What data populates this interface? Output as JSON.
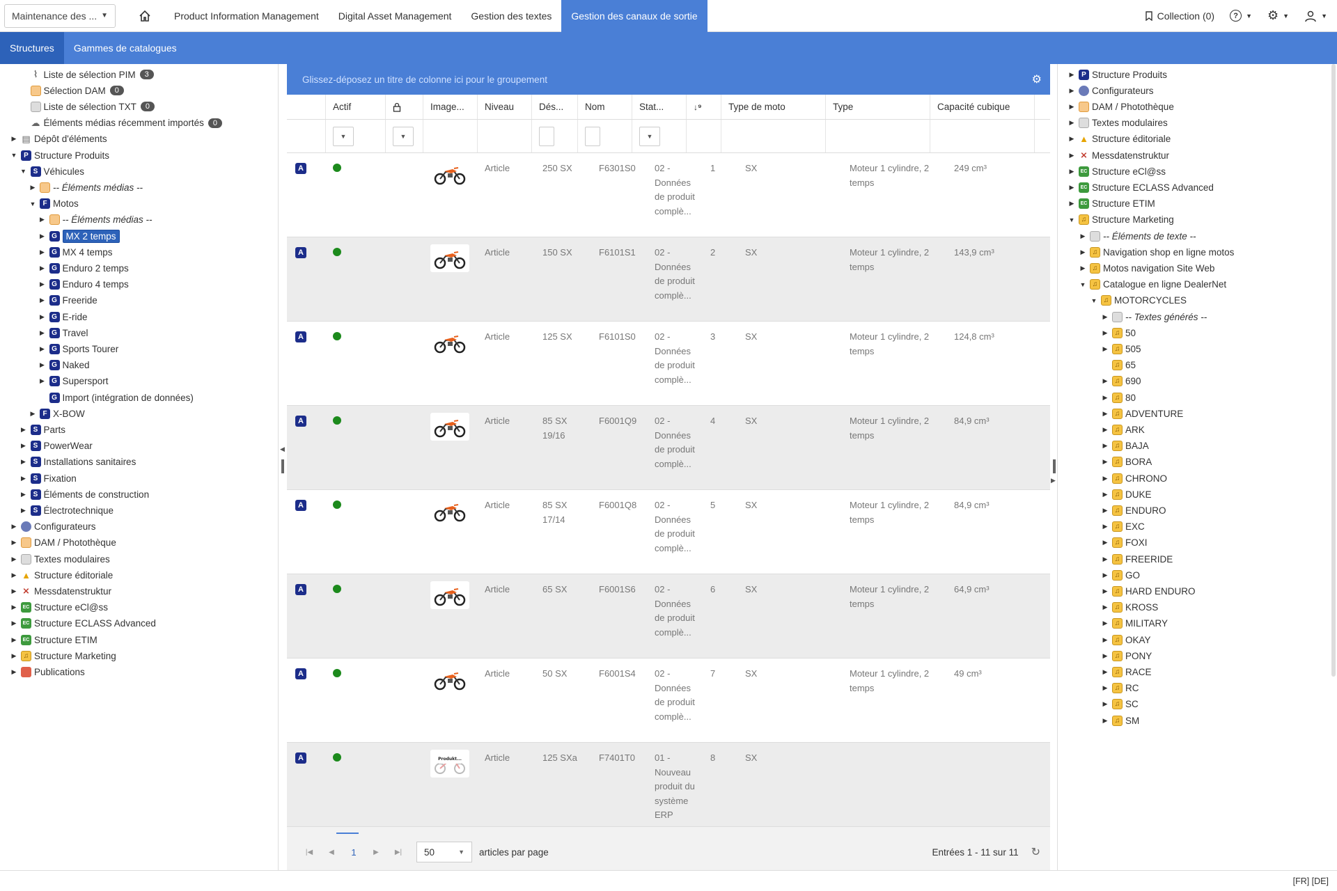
{
  "topbar": {
    "context_select": "Maintenance des ...",
    "nav_tabs": [
      {
        "label": "Product Information Management"
      },
      {
        "label": "Digital Asset Management"
      },
      {
        "label": "Gestion des textes"
      },
      {
        "label": "Gestion des canaux de sortie"
      }
    ],
    "active_tab": "Gestion des canaux de sortie",
    "collection": "Collection (0)"
  },
  "subbar": {
    "tabs": [
      {
        "label": "Structures"
      },
      {
        "label": "Gammes de catalogues"
      }
    ]
  },
  "left_tree": [
    {
      "label": "Liste de sélection PIM",
      "icon": "paperclip-icon",
      "badge": "3",
      "depth": 1,
      "toggle": ""
    },
    {
      "label": "Sélection DAM",
      "icon": "image-icon",
      "badge": "0",
      "depth": 1,
      "toggle": ""
    },
    {
      "label": "Liste de sélection TXT",
      "icon": "text-icon",
      "badge": "0",
      "depth": 1,
      "toggle": ""
    },
    {
      "label": "Éléments médias récemment importés",
      "icon": "import-icon",
      "badge": "0",
      "depth": 1,
      "toggle": ""
    },
    {
      "label": "Dépôt d'éléments",
      "icon": "clipboard-icon",
      "depth": 0,
      "toggle": "closed"
    },
    {
      "label": "Structure Produits",
      "icon": "P",
      "depth": 0,
      "toggle": "open"
    },
    {
      "label": "Véhicules",
      "icon": "S",
      "depth": 1,
      "toggle": "open"
    },
    {
      "label": "-- Éléments médias --",
      "icon": "dam-icon",
      "depth": 2,
      "toggle": "closed",
      "italic": true
    },
    {
      "label": "Motos",
      "icon": "F",
      "depth": 2,
      "toggle": "open"
    },
    {
      "label": "-- Éléments médias --",
      "icon": "dam-icon",
      "depth": 3,
      "toggle": "closed",
      "italic": true
    },
    {
      "label": "MX 2 temps",
      "icon": "G",
      "depth": 3,
      "toggle": "closed",
      "selected": true
    },
    {
      "label": "MX 4 temps",
      "icon": "G",
      "depth": 3,
      "toggle": "closed"
    },
    {
      "label": "Enduro 2 temps",
      "icon": "G",
      "depth": 3,
      "toggle": "closed"
    },
    {
      "label": "Enduro 4 temps",
      "icon": "G",
      "depth": 3,
      "toggle": "closed"
    },
    {
      "label": "Freeride",
      "icon": "G",
      "depth": 3,
      "toggle": "closed"
    },
    {
      "label": "E-ride",
      "icon": "G",
      "depth": 3,
      "toggle": "closed"
    },
    {
      "label": "Travel",
      "icon": "G",
      "depth": 3,
      "toggle": "closed"
    },
    {
      "label": "Sports Tourer",
      "icon": "G",
      "depth": 3,
      "toggle": "closed"
    },
    {
      "label": "Naked",
      "icon": "G",
      "depth": 3,
      "toggle": "closed"
    },
    {
      "label": "Supersport",
      "icon": "G",
      "depth": 3,
      "toggle": "closed"
    },
    {
      "label": "Import (intégration de données)",
      "icon": "G",
      "depth": 3,
      "toggle": ""
    },
    {
      "label": "X-BOW",
      "icon": "F",
      "depth": 2,
      "toggle": "closed"
    },
    {
      "label": "Parts",
      "icon": "S",
      "depth": 1,
      "toggle": "closed"
    },
    {
      "label": "PowerWear",
      "icon": "S",
      "depth": 1,
      "toggle": "closed"
    },
    {
      "label": "Installations sanitaires",
      "icon": "S",
      "depth": 1,
      "toggle": "closed"
    },
    {
      "label": "Fixation",
      "icon": "S",
      "depth": 1,
      "toggle": "closed"
    },
    {
      "label": "Éléments de construction",
      "icon": "S",
      "depth": 1,
      "toggle": "closed"
    },
    {
      "label": "Électrotechnique",
      "icon": "S",
      "depth": 1,
      "toggle": "closed"
    },
    {
      "label": "Configurateurs",
      "icon": "cfg-icon",
      "depth": 0,
      "toggle": "closed"
    },
    {
      "label": "DAM / Photothèque",
      "icon": "dam-icon",
      "depth": 0,
      "toggle": "closed"
    },
    {
      "label": "Textes modulaires",
      "icon": "txt-icon",
      "depth": 0,
      "toggle": "closed"
    },
    {
      "label": "Structure éditoriale",
      "icon": "edit-icon",
      "depth": 0,
      "toggle": "closed"
    },
    {
      "label": "Messdatenstruktur",
      "icon": "mess-icon",
      "depth": 0,
      "toggle": "closed"
    },
    {
      "label": "Structure eCl@ss",
      "icon": "eclass-icon",
      "depth": 0,
      "toggle": "closed"
    },
    {
      "label": "Structure ECLASS Advanced",
      "icon": "eclass-icon",
      "depth": 0,
      "toggle": "closed"
    },
    {
      "label": "Structure ETIM",
      "icon": "eclass-icon",
      "depth": 0,
      "toggle": "closed"
    },
    {
      "label": "Structure Marketing",
      "icon": "mkt-icon",
      "depth": 0,
      "toggle": "closed"
    },
    {
      "label": "Publications",
      "icon": "pub-icon",
      "depth": 0,
      "toggle": "closed"
    }
  ],
  "grid": {
    "group_hint": "Glissez-déposez un titre de colonne ici pour le groupement",
    "columns": [
      "Actif",
      "Image...",
      "Niveau",
      "Dés...",
      "Nom",
      "Stat...",
      "Type de moto",
      "Type",
      "Capacité cubique"
    ],
    "rows": [
      {
        "niveau": "Article",
        "des": "250 SX",
        "nom": "F6301S0",
        "stat": "02 - Données de produit complè...",
        "num": "1",
        "moto": "SX",
        "type": "Moteur 1 cylindre, 2 temps",
        "cap": "249 cm³"
      },
      {
        "niveau": "Article",
        "des": "150 SX",
        "nom": "F6101S1",
        "stat": "02 - Données de produit complè...",
        "num": "2",
        "moto": "SX",
        "type": "Moteur 1 cylindre, 2 temps",
        "cap": "143,9 cm³"
      },
      {
        "niveau": "Article",
        "des": "125 SX",
        "nom": "F6101S0",
        "stat": "02 - Données de produit complè...",
        "num": "3",
        "moto": "SX",
        "type": "Moteur 1 cylindre, 2 temps",
        "cap": "124,8 cm³"
      },
      {
        "niveau": "Article",
        "des": "85 SX 19/16",
        "nom": "F6001Q9",
        "stat": "02 - Données de produit complè...",
        "num": "4",
        "moto": "SX",
        "type": "Moteur 1 cylindre, 2 temps",
        "cap": "84,9 cm³"
      },
      {
        "niveau": "Article",
        "des": "85 SX 17/14",
        "nom": "F6001Q8",
        "stat": "02 - Données de produit complè...",
        "num": "5",
        "moto": "SX",
        "type": "Moteur 1 cylindre, 2 temps",
        "cap": "84,9 cm³"
      },
      {
        "niveau": "Article",
        "des": "65 SX",
        "nom": "F6001S6",
        "stat": "02 - Données de produit complè...",
        "num": "6",
        "moto": "SX",
        "type": "Moteur 1 cylindre, 2 temps",
        "cap": "64,9 cm³"
      },
      {
        "niveau": "Article",
        "des": "50 SX",
        "nom": "F6001S4",
        "stat": "02 - Données de produit complè...",
        "num": "7",
        "moto": "SX",
        "type": "Moteur 1 cylindre, 2 temps",
        "cap": "49 cm³"
      },
      {
        "niveau": "Article",
        "des": "125 SXa",
        "nom": "F7401T0",
        "stat": "01 - Nouveau produit du système ERP",
        "num": "8",
        "moto": "SX",
        "type": "",
        "cap": "",
        "placeholder_image": true
      }
    ],
    "pager": {
      "page": "1",
      "page_size": "50",
      "per_page_label": "articles par page",
      "entries": "Entrées 1 - 11 sur 11"
    }
  },
  "right_tree": [
    {
      "label": "Structure Produits",
      "icon": "P",
      "depth": 0,
      "toggle": "closed"
    },
    {
      "label": "Configurateurs",
      "icon": "cfg-icon",
      "depth": 0,
      "toggle": "closed"
    },
    {
      "label": "DAM / Photothèque",
      "icon": "dam-icon",
      "depth": 0,
      "toggle": "closed"
    },
    {
      "label": "Textes modulaires",
      "icon": "txt-icon",
      "depth": 0,
      "toggle": "closed"
    },
    {
      "label": "Structure éditoriale",
      "icon": "edit-icon",
      "depth": 0,
      "toggle": "closed"
    },
    {
      "label": "Messdatenstruktur",
      "icon": "mess-icon",
      "depth": 0,
      "toggle": "closed"
    },
    {
      "label": "Structure eCl@ss",
      "icon": "eclass-icon",
      "depth": 0,
      "toggle": "closed"
    },
    {
      "label": "Structure ECLASS Advanced",
      "icon": "eclass-icon",
      "depth": 0,
      "toggle": "closed"
    },
    {
      "label": "Structure ETIM",
      "icon": "eclass-icon",
      "depth": 0,
      "toggle": "closed"
    },
    {
      "label": "Structure Marketing",
      "icon": "mkt-icon",
      "depth": 0,
      "toggle": "open"
    },
    {
      "label": "-- Éléments de texte --",
      "icon": "txt-icon",
      "depth": 1,
      "toggle": "closed",
      "italic": true
    },
    {
      "label": "Navigation shop en ligne motos",
      "icon": "mkt-icon",
      "depth": 1,
      "toggle": "closed"
    },
    {
      "label": "Motos navigation Site Web",
      "icon": "mkt-icon",
      "depth": 1,
      "toggle": "closed"
    },
    {
      "label": "Catalogue en ligne DealerNet",
      "icon": "mkt-icon",
      "depth": 1,
      "toggle": "open"
    },
    {
      "label": "MOTORCYCLES",
      "icon": "mkt-icon",
      "depth": 2,
      "toggle": "open"
    },
    {
      "label": "-- Textes générés --",
      "icon": "txt-icon",
      "depth": 3,
      "toggle": "closed",
      "italic": true
    },
    {
      "label": "50",
      "icon": "mkt-icon",
      "depth": 3,
      "toggle": "closed"
    },
    {
      "label": "505",
      "icon": "mkt-icon",
      "depth": 3,
      "toggle": "closed"
    },
    {
      "label": "65",
      "icon": "mkt-icon",
      "depth": 3,
      "toggle": ""
    },
    {
      "label": "690",
      "icon": "mkt-icon",
      "depth": 3,
      "toggle": "closed"
    },
    {
      "label": "80",
      "icon": "mkt-icon",
      "depth": 3,
      "toggle": "closed"
    },
    {
      "label": "ADVENTURE",
      "icon": "mkt-icon",
      "depth": 3,
      "toggle": "closed"
    },
    {
      "label": "ARK",
      "icon": "mkt-icon",
      "depth": 3,
      "toggle": "closed"
    },
    {
      "label": "BAJA",
      "icon": "mkt-icon",
      "depth": 3,
      "toggle": "closed"
    },
    {
      "label": "BORA",
      "icon": "mkt-icon",
      "depth": 3,
      "toggle": "closed"
    },
    {
      "label": "CHRONO",
      "icon": "mkt-icon",
      "depth": 3,
      "toggle": "closed"
    },
    {
      "label": "DUKE",
      "icon": "mkt-icon",
      "depth": 3,
      "toggle": "closed"
    },
    {
      "label": "ENDURO",
      "icon": "mkt-icon",
      "depth": 3,
      "toggle": "closed"
    },
    {
      "label": "EXC",
      "icon": "mkt-icon",
      "depth": 3,
      "toggle": "closed"
    },
    {
      "label": "FOXI",
      "icon": "mkt-icon",
      "depth": 3,
      "toggle": "closed"
    },
    {
      "label": "FREERIDE",
      "icon": "mkt-icon",
      "depth": 3,
      "toggle": "closed"
    },
    {
      "label": "GO",
      "icon": "mkt-icon",
      "depth": 3,
      "toggle": "closed"
    },
    {
      "label": "HARD ENDURO",
      "icon": "mkt-icon",
      "depth": 3,
      "toggle": "closed"
    },
    {
      "label": "KROSS",
      "icon": "mkt-icon",
      "depth": 3,
      "toggle": "closed"
    },
    {
      "label": "MILITARY",
      "icon": "mkt-icon",
      "depth": 3,
      "toggle": "closed"
    },
    {
      "label": "OKAY",
      "icon": "mkt-icon",
      "depth": 3,
      "toggle": "closed"
    },
    {
      "label": "PONY",
      "icon": "mkt-icon",
      "depth": 3,
      "toggle": "closed"
    },
    {
      "label": "RACE",
      "icon": "mkt-icon",
      "depth": 3,
      "toggle": "closed"
    },
    {
      "label": "RC",
      "icon": "mkt-icon",
      "depth": 3,
      "toggle": "closed"
    },
    {
      "label": "SC",
      "icon": "mkt-icon",
      "depth": 3,
      "toggle": "closed"
    },
    {
      "label": "SM",
      "icon": "mkt-icon",
      "depth": 3,
      "toggle": "closed"
    }
  ],
  "footer": {
    "languages": "[FR] [DE]"
  },
  "colors": {
    "accent": "#4a7fd6",
    "accent_dark": "#2d62b9",
    "navy": "#1c2d8a",
    "active_green": "#1c8a1c"
  }
}
